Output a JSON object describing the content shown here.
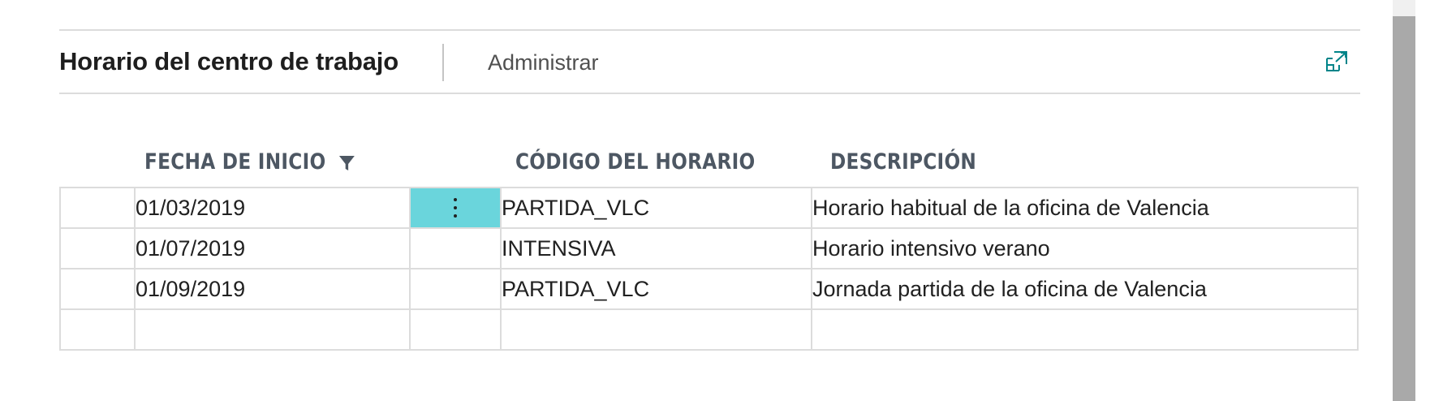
{
  "header": {
    "title": "Horario del centro de trabajo",
    "action_label": "Administrar",
    "expand_icon": "expand-icon"
  },
  "columns": {
    "start_date": "FECHA DE INICIO",
    "schedule_code": "CÓDIGO DEL HORARIO",
    "description": "DESCRIPCIÓN"
  },
  "rows": [
    {
      "start_date": "01/03/2019",
      "schedule_code": "PARTIDA_VLC",
      "description": "Horario habitual de la oficina de Valencia",
      "selected": true
    },
    {
      "start_date": "01/07/2019",
      "schedule_code": "INTENSIVA",
      "description": "Horario intensivo verano",
      "selected": false
    },
    {
      "start_date": "01/09/2019",
      "schedule_code": "PARTIDA_VLC",
      "description": "Jornada partida de la oficina de Valencia",
      "selected": false
    },
    {
      "start_date": "",
      "schedule_code": "",
      "description": "",
      "selected": false
    }
  ],
  "colors": {
    "accent": "#008489",
    "selected_row_menu": "#6ad5dc",
    "header_text": "#4d5763"
  },
  "icons": {
    "filter": "filter-icon",
    "row_menu": "vertical-ellipsis-icon"
  }
}
